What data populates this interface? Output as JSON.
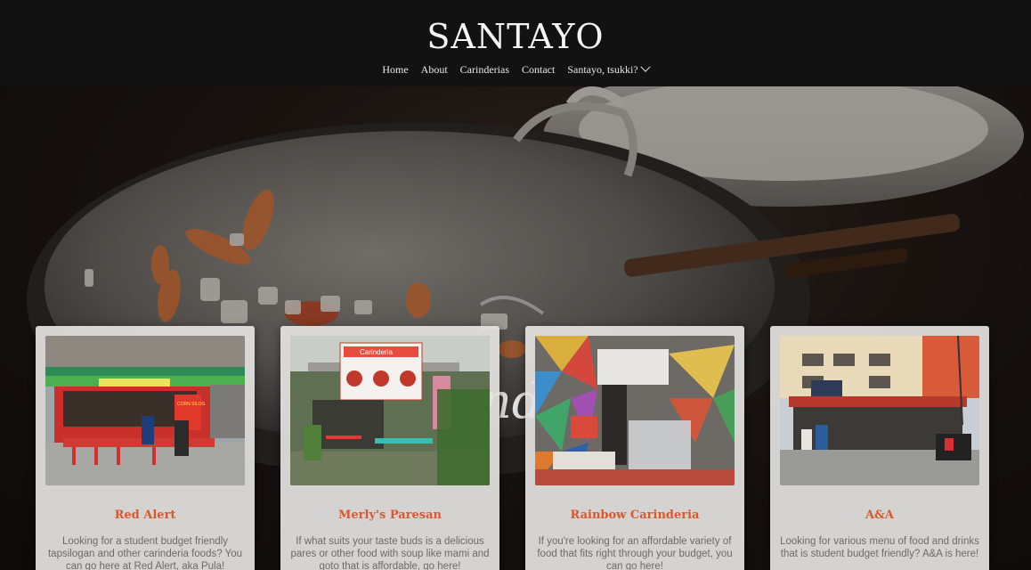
{
  "header": {
    "brand": "SANTAYO",
    "nav": [
      "Home",
      "About",
      "Carinderias",
      "Contact",
      "Santayo, tsukki?"
    ]
  },
  "hero": {
    "script_fragment": "nd"
  },
  "cards": [
    {
      "name": "Red Alert",
      "description": "Looking for a student budget friendly tapsilogan and other carinderia foods? You can go here at Red Alert, aka Pula!",
      "sign_text": "CORN SILOG"
    },
    {
      "name": "Merly's Paresan",
      "description": "If what suits your taste buds is a delicious pares or other food with soup like mami and goto that is affordable, go here!",
      "sign_text": "Carinderia"
    },
    {
      "name": "Rainbow Carinderia",
      "description": "If you're looking for an affordable variety of food that fits right through your budget, you can go here!",
      "sign_text": ""
    },
    {
      "name": "A&A",
      "description": "Looking for various menu of food and drinks that is student budget friendly? A&A is here!",
      "sign_text": ""
    }
  ],
  "colors": {
    "header_bg": "#121212",
    "accent": "#d9582d",
    "card_bg": "#e6e4e2",
    "desc_text": "#6b6b6b"
  }
}
